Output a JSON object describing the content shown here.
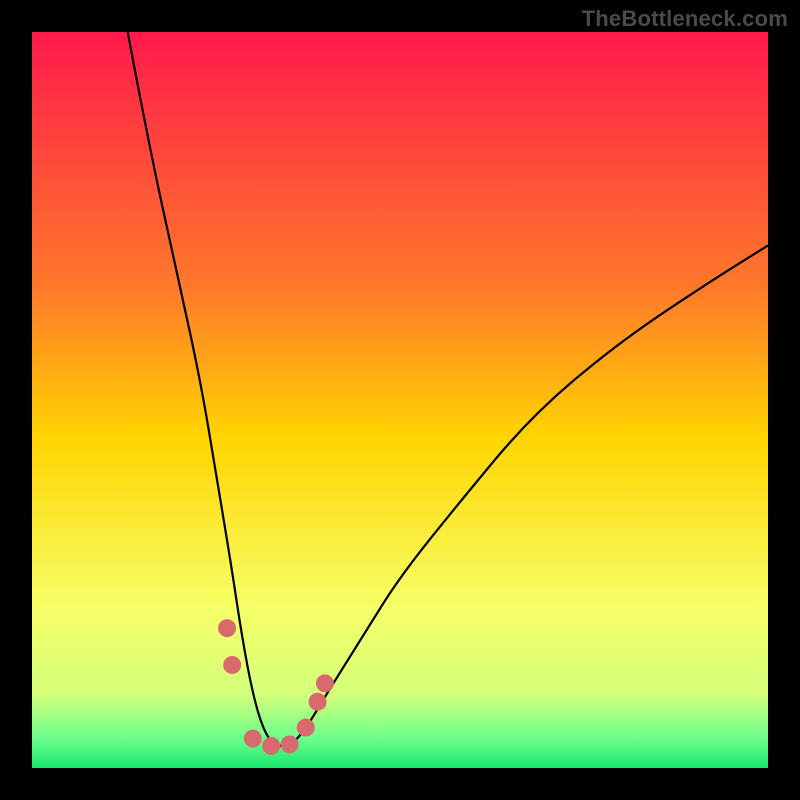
{
  "watermark": "TheBottleneck.com",
  "chart_data": {
    "type": "line",
    "title": "",
    "xlabel": "",
    "ylabel": "",
    "xlim": [
      0,
      100
    ],
    "ylim": [
      0,
      100
    ],
    "gradient_stops": [
      {
        "offset": 0,
        "color": "#ff1a4b"
      },
      {
        "offset": 0.35,
        "color": "#ff7a2a"
      },
      {
        "offset": 0.55,
        "color": "#ffd400"
      },
      {
        "offset": 0.78,
        "color": "#f6ff66"
      },
      {
        "offset": 0.9,
        "color": "#d4ff7a"
      },
      {
        "offset": 0.96,
        "color": "#6cff8c"
      },
      {
        "offset": 1.0,
        "color": "#17e86b"
      }
    ],
    "series": [
      {
        "name": "bottleneck-curve",
        "x": [
          13,
          16,
          20,
          23,
          25,
          27,
          28.5,
          30,
          31.5,
          33,
          35,
          37,
          40,
          45,
          50,
          58,
          68,
          80,
          92,
          100
        ],
        "y": [
          100,
          84,
          66,
          52,
          40,
          28,
          18,
          10,
          5,
          3,
          3,
          5,
          10,
          18,
          26,
          36,
          48,
          58,
          66,
          71
        ]
      }
    ],
    "markers": {
      "name": "highlight-points",
      "color": "#d86a6e",
      "radius": 9,
      "points": [
        {
          "x": 26.5,
          "y": 19
        },
        {
          "x": 27.2,
          "y": 14
        },
        {
          "x": 30.0,
          "y": 4.0
        },
        {
          "x": 32.5,
          "y": 3.0
        },
        {
          "x": 35.0,
          "y": 3.2
        },
        {
          "x": 37.2,
          "y": 5.5
        },
        {
          "x": 38.8,
          "y": 9.0
        },
        {
          "x": 39.8,
          "y": 11.5
        }
      ]
    }
  }
}
